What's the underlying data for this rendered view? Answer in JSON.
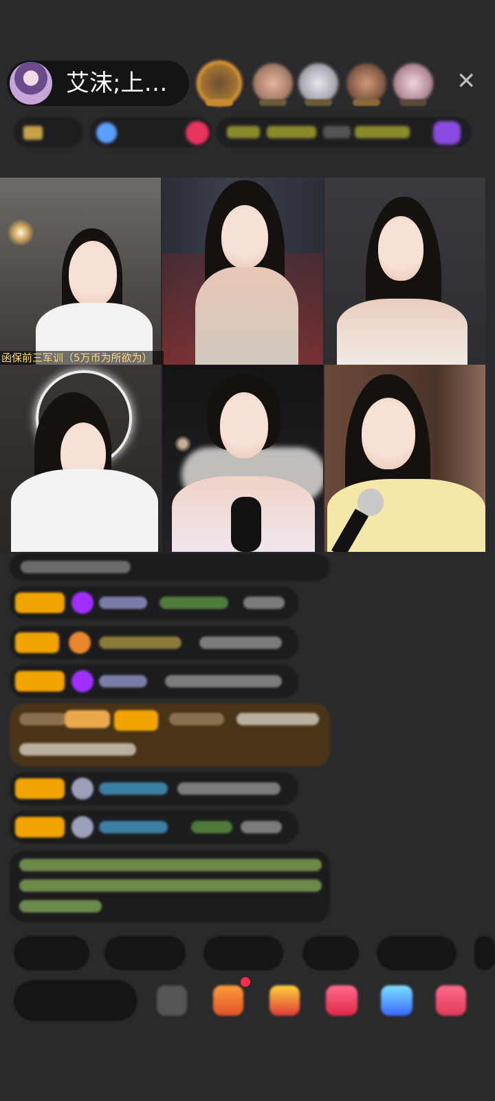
{
  "header": {
    "host_name": "艾沫;上…",
    "close_icon": "✕"
  },
  "video_grid": {
    "caption": "函保前三军训（5万币为所欲为）"
  },
  "chat": {
    "messages_count_visible": 8
  },
  "quick_replies": [
    "",
    "",
    "",
    "",
    ""
  ],
  "input": {
    "placeholder": ""
  },
  "colors": {
    "background": "#2a2a2c",
    "badge_gold": "#f2a400",
    "gem_purple": "#a02fff",
    "chat_green": "#9ccf6a",
    "chat_cyan": "#3b9ec4"
  }
}
